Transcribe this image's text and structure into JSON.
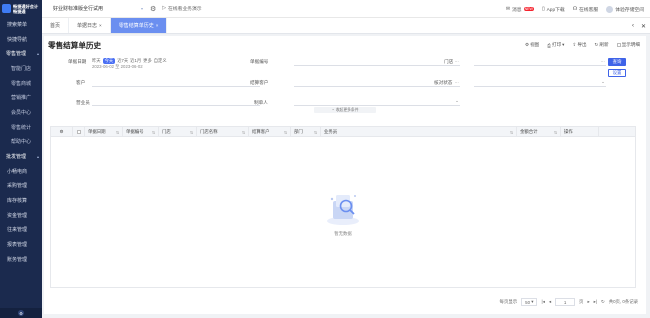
{
  "brand": {
    "name_line1": "畅捷通好会计",
    "name_line2": "畅捷通"
  },
  "sidebar": {
    "items": [
      {
        "label": "搜索菜单",
        "kind": "item"
      },
      {
        "label": "快捷导航",
        "kind": "item"
      },
      {
        "label": "零售管理",
        "kind": "group"
      },
      {
        "label": "智能门店",
        "kind": "sub"
      },
      {
        "label": "零售商城",
        "kind": "sub"
      },
      {
        "label": "营销推广",
        "kind": "sub"
      },
      {
        "label": "会员中心",
        "kind": "sub"
      },
      {
        "label": "零售统计",
        "kind": "sub"
      },
      {
        "label": "帮助中心",
        "kind": "sub"
      },
      {
        "label": "批发管理",
        "kind": "group"
      },
      {
        "label": "小畅电商",
        "kind": "item"
      },
      {
        "label": "采购管理",
        "kind": "item"
      },
      {
        "label": "库存核算",
        "kind": "item"
      },
      {
        "label": "资金管理",
        "kind": "item"
      },
      {
        "label": "往来管理",
        "kind": "item"
      },
      {
        "label": "报表管理",
        "kind": "item"
      },
      {
        "label": "账务管理",
        "kind": "item"
      }
    ],
    "bottom_icon": "settings-icon"
  },
  "header": {
    "store": "好业财标准版全行试用",
    "settings_icon": "gear-icon",
    "link": "在线看业务演示",
    "right": {
      "message": "消息",
      "new_badge": "NEW",
      "app": "App下载",
      "ai": "在线客服",
      "user": "体验存储空间"
    }
  },
  "tabs": [
    {
      "label": "首页",
      "active": false,
      "closable": false
    },
    {
      "label": "单据日志",
      "active": false,
      "closable": true
    },
    {
      "label": "零售结算单历史",
      "active": true,
      "closable": true
    }
  ],
  "tab_controls": {
    "collapse": "‹",
    "more": "✕"
  },
  "page": {
    "title": "零售结算单历史",
    "toolbar": {
      "columns": "视图",
      "print": "打印",
      "export": "导出",
      "refresh": "刷新",
      "show_detail": "显示明细"
    }
  },
  "filters": {
    "date_label": "单据日期",
    "date_tags": [
      "昨天",
      "今天",
      "近7天",
      "近1月",
      "更多",
      "自定义"
    ],
    "date_active": "今天",
    "date_range": "2023-06-02 至 2023-06-02",
    "doc_no_label": "单据编号",
    "store_label": "门店",
    "customer_label": "客户",
    "settle_customer_label": "结算客户",
    "status_label": "核对状态",
    "operator_label": "营业员",
    "creator_label": "制单人",
    "search_button": "查询",
    "reset_button": "设置",
    "toggle": "收起更多条件"
  },
  "table": {
    "columns": [
      "单据日期",
      "单据编号",
      "门店",
      "门店名称",
      "结算客户",
      "部门",
      "业务员",
      "金额合计",
      "操作"
    ],
    "empty_text": "暂无数据"
  },
  "pager": {
    "per_page_label": "每页显示",
    "per_page": "50",
    "page": "1",
    "total_pages": "页",
    "summary": "共0页, 0条记录"
  },
  "colors": {
    "sidebar": "#1b2a4e",
    "accent": "#3f63e8",
    "tab_active": "#6b8ff0"
  }
}
